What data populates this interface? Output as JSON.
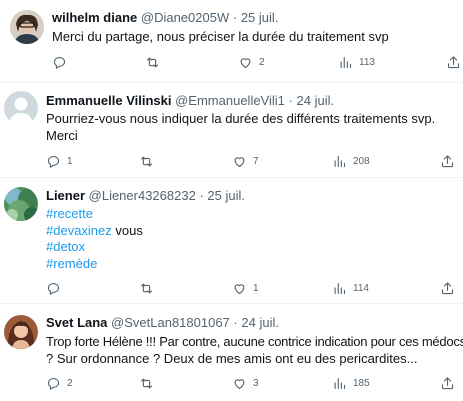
{
  "tweets": [
    {
      "name": "wilhelm diane",
      "handle": "@Diane0205W",
      "sep": "·",
      "date": "25 juil.",
      "lines": [
        "Merci du partage, nous préciser la durée du traitement svp"
      ],
      "counts": {
        "replies": "",
        "retweets": "",
        "likes": "2",
        "views": "113"
      }
    },
    {
      "name": "Emmanuelle Vilinski",
      "handle": "@EmmanuelleVili1",
      "sep": "·",
      "date": "24 juil.",
      "lines": [
        "Pourriez-vous nous indiquer la durée des différents traitements svp.",
        "Merci"
      ],
      "counts": {
        "replies": "1",
        "retweets": "",
        "likes": "7",
        "views": "208"
      }
    },
    {
      "name": "Liener",
      "handle": "@Liener43268232",
      "sep": "·",
      "date": "25 juil.",
      "tags": [
        "#recette",
        "#devaxinez",
        "#detox",
        "#remède"
      ],
      "tag_suffix": " vous",
      "counts": {
        "replies": "",
        "retweets": "",
        "likes": "1",
        "views": "114"
      }
    },
    {
      "name": "Svet Lana",
      "handle": "@SvetLan81801067",
      "sep": "·",
      "date": "24 juil.",
      "lines": [
        "Trop forte Hélène !!! Par contre, aucune contrice indication pour ces médocs",
        "? Sur ordonnance ? Deux de mes amis ont eu des pericardites..."
      ],
      "counts": {
        "replies": "2",
        "retweets": "",
        "likes": "3",
        "views": "185"
      }
    }
  ],
  "icons": [
    "reply-icon",
    "retweet-icon",
    "like-icon",
    "views-icon",
    "share-icon"
  ],
  "colors": {
    "text": "#0f1419",
    "muted": "#536471",
    "hashtag": "#1d9bf0",
    "divider": "#eff3f4"
  }
}
